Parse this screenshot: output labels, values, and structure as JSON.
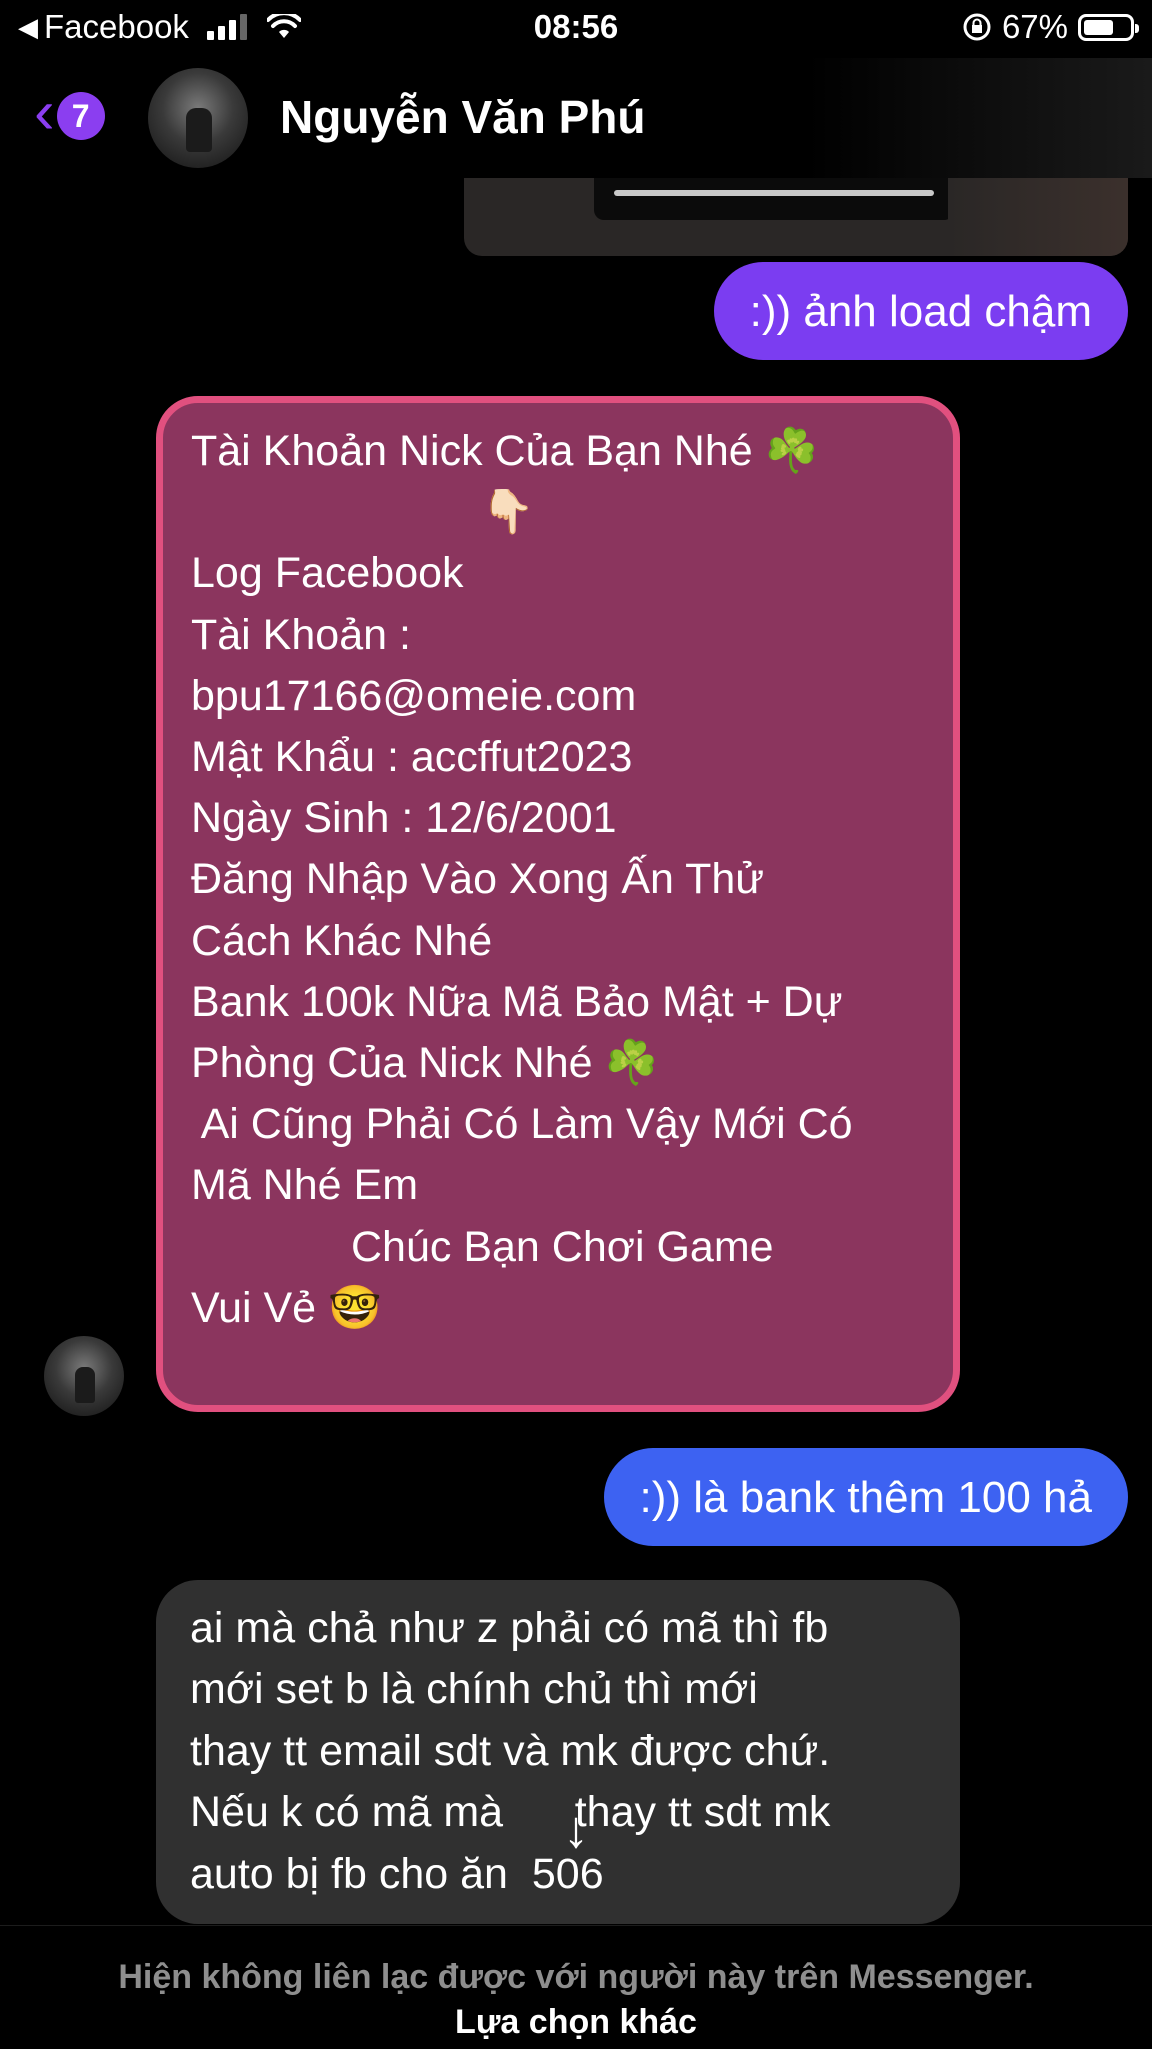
{
  "status_bar": {
    "back_app": "Facebook",
    "time": "08:56",
    "battery": "67%",
    "battery_level": 0.67
  },
  "header": {
    "back_badge": "7",
    "contact_name": "Nguyễn Văn Phú"
  },
  "messages": {
    "out_1": ":)) ảnh load chậm",
    "card_lines": [
      "Tài Khoản Nick Của Bạn Nhé ☘️",
      "👇🏻",
      "Log Facebook",
      "Tài Khoản :",
      "bpu17166@omeie.com",
      "Mật Khẩu : accffut2023",
      "Ngày Sinh : 12/6/2001",
      "Đăng Nhập Vào Xong Ấn Thử",
      "Cách Khác Nhé",
      "Bank 100k Nữa Mã Bảo Mật + Dự",
      "Phòng Của Nick Nhé ☘️",
      " Ai Cũng Phải Có Làm Vậy Mới Có",
      "Mã Nhé Em",
      "",
      "Chúc Bạn Chơi Game",
      "Vui Vẻ 🤓"
    ],
    "out_2": ":)) là bank thêm 100 hả",
    "in_2_lines": [
      "ai mà chả như z phải có mã thì fb",
      "mới set b là chính chủ thì mới",
      "thay tt email sdt và mk được chứ.",
      "Nếu k có mã mà      thay tt sdt mk",
      "auto bị fb cho ăn  506"
    ]
  },
  "scroll_icon": "↓",
  "footer": {
    "note": "Hiện không liên lạc được với người này trên Messenger.",
    "link": "Lựa chọn khác"
  },
  "colors": {
    "accent_purple": "#7b3df1",
    "bubble_blue": "#3d62f2",
    "card_fill": "#8b355e",
    "card_border": "#e1507f",
    "incoming_gray": "#303030"
  }
}
